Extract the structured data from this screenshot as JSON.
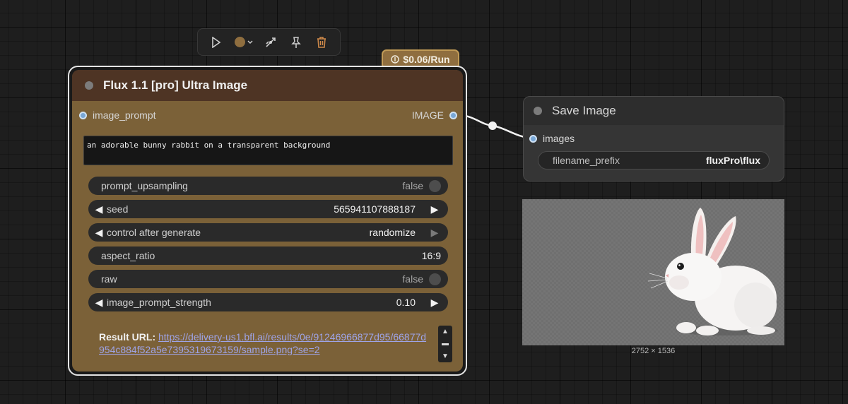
{
  "toolbar": {
    "icons": [
      "play-icon",
      "color-picker-icon",
      "bypass-icon",
      "pin-icon",
      "delete-icon"
    ]
  },
  "badge": {
    "label": "$0.06/Run"
  },
  "flux_node": {
    "title": "Flux 1.1 [pro] Ultra Image",
    "input_label": "image_prompt",
    "output_label": "IMAGE",
    "prompt_text": "an adorable bunny rabbit on a transparent background",
    "widgets": {
      "prompt_upsampling": {
        "label": "prompt_upsampling",
        "value": "false"
      },
      "seed": {
        "label": "seed",
        "value": "565941107888187"
      },
      "control_after_generate": {
        "label": "control after generate",
        "value": "randomize"
      },
      "aspect_ratio": {
        "label": "aspect_ratio",
        "value": "16:9"
      },
      "raw": {
        "label": "raw",
        "value": "false"
      },
      "image_prompt_strength": {
        "label": "image_prompt_strength",
        "value": "0.10"
      }
    },
    "result_label": "Result URL:",
    "result_url": "https://delivery-us1.bfl.ai/results/0e/91246966877d95/66877d954c884f52a5e7395319673159/sample.png?se=2"
  },
  "save_node": {
    "title": "Save Image",
    "input_label": "images",
    "filename_prefix_label": "filename_prefix",
    "filename_prefix_value": "fluxPro\\flux"
  },
  "preview": {
    "dimensions": "2752 × 1536"
  },
  "colors": {
    "canvas": "#1e1e1e",
    "flux_header": "#4e3424",
    "flux_body": "#7b6138",
    "badge": "#8f6e3f",
    "port": "#78a7d6",
    "link": "#9ea4e8"
  }
}
